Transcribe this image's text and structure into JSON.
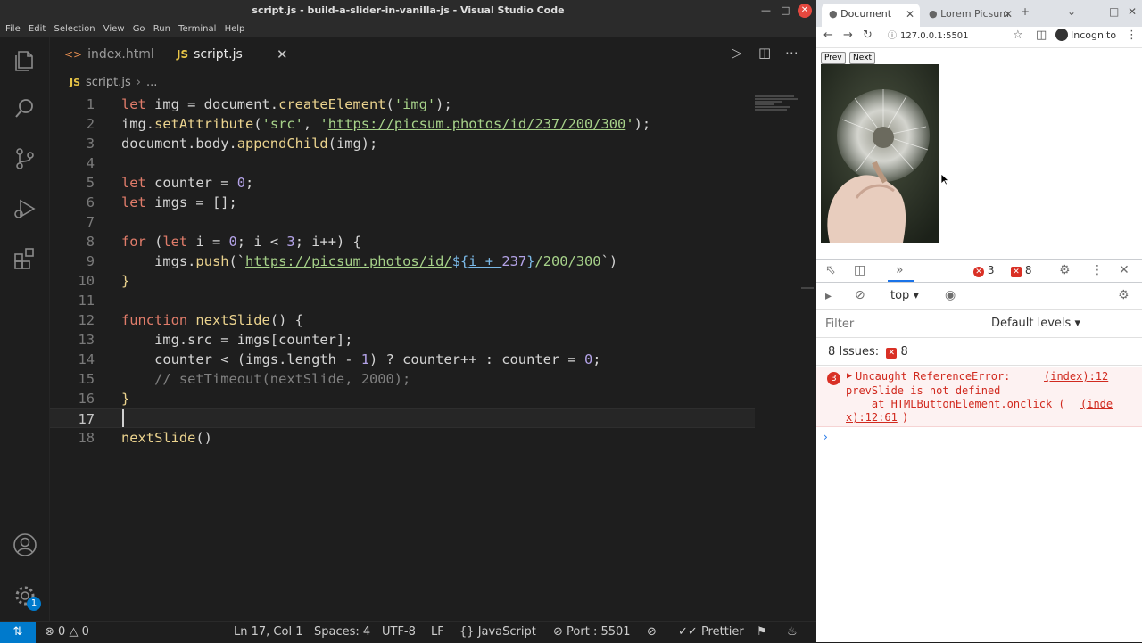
{
  "vscode": {
    "title": "script.js - build-a-slider-in-vanilla-js - Visual Studio Code",
    "menu": [
      "File",
      "Edit",
      "Selection",
      "View",
      "Go",
      "Run",
      "Terminal",
      "Help"
    ],
    "tabs": [
      {
        "label": "index.html",
        "icon": "html-tag-icon"
      },
      {
        "label": "script.js",
        "icon": "js-icon"
      }
    ],
    "tab_js_badge": "JS",
    "breadcrumb": {
      "file": "script.js",
      "rest": "..."
    },
    "account_badge": "1",
    "lines": [
      {
        "n": "1"
      },
      {
        "n": "2"
      },
      {
        "n": "3"
      },
      {
        "n": "4"
      },
      {
        "n": "5"
      },
      {
        "n": "6"
      },
      {
        "n": "7"
      },
      {
        "n": "8"
      },
      {
        "n": "9"
      },
      {
        "n": "10"
      },
      {
        "n": "11"
      },
      {
        "n": "12"
      },
      {
        "n": "13"
      },
      {
        "n": "14"
      },
      {
        "n": "15"
      },
      {
        "n": "16"
      },
      {
        "n": "17"
      },
      {
        "n": "18"
      }
    ],
    "code": {
      "l1": {
        "kw": "let",
        "rest1": " img = document.",
        "fn": "createElement",
        "rest2": "(",
        "str": "'img'",
        "rest3": ");"
      },
      "l2": {
        "a": "img.",
        "fn": "setAttribute",
        "b": "(",
        "s1": "'src'",
        "c": ", ",
        "s2q1": "'",
        "url": "https://picsum.photos/id/237/200/300",
        "s2q2": "'",
        "d": ");"
      },
      "l3": {
        "a": "document.body.",
        "fn": "appendChild",
        "b": "(img);"
      },
      "l5": {
        "kw": "let",
        "a": " counter = ",
        "num": "0",
        "b": ";"
      },
      "l6": {
        "kw": "let",
        "a": " imgs = [];"
      },
      "l8": {
        "kw": "for",
        "a": " (",
        "kw2": "let",
        "b": " i = ",
        "n1": "0",
        "c": "; i < ",
        "n2": "3",
        "d": "; i++) {"
      },
      "l9": {
        "indent": "    ",
        "a": "imgs.",
        "fn": "push",
        "b": "(`",
        "url": "https://picsum.photos/id/",
        "t1": "${",
        "t2": "i + ",
        "tnum": "237",
        "t3": "}",
        "rest": "/200/300",
        "end": "`)"
      },
      "l10": {
        "a": "}"
      },
      "l12": {
        "kw": "function",
        "a": " ",
        "fn": "nextSlide",
        "b": "() {"
      },
      "l13": {
        "indent": "    ",
        "a": "img.src = imgs[counter];"
      },
      "l14": {
        "indent": "    ",
        "a": "counter < (imgs.length - ",
        "n1": "1",
        "b": ") ? counter++ : counter = ",
        "n2": "0",
        "c": ";"
      },
      "l15": {
        "indent": "    ",
        "cmt": "// setTimeout(nextSlide, 2000);"
      },
      "l16": {
        "a": "}"
      },
      "l18": {
        "fn": "nextSlide",
        "a": "()"
      }
    },
    "status": {
      "errors": "0",
      "warnings": "0",
      "position": "Ln 17, Col 1",
      "spaces": "Spaces: 4",
      "encoding": "UTF-8",
      "eol": "LF",
      "language": "JavaScript",
      "port": "Port : 5501",
      "prettier": "Prettier"
    }
  },
  "browser": {
    "tabs": [
      {
        "label": "Document"
      },
      {
        "label": "Lorem Picsum"
      }
    ],
    "url": "127.0.0.1:5501",
    "profile": "Incognito",
    "page": {
      "prev": "Prev",
      "next": "Next"
    },
    "devtools": {
      "error_count": "3",
      "issue_count": "8",
      "context": "top",
      "filter_placeholder": "Filter",
      "levels": "Default levels",
      "issues_label": "8 Issues:",
      "issues_num": "8",
      "error": {
        "repeat": "3",
        "message": "Uncaught ReferenceError:",
        "message2": "prevSlide is not defined",
        "source": "(index):12",
        "stack": "    at HTMLButtonElement.onclick (",
        "stack_link1": "(inde",
        "stack_link2": "x):12:61",
        "stack_end": ")"
      }
    }
  },
  "colors": {
    "accent": "#007acc",
    "error": "#d93025"
  }
}
